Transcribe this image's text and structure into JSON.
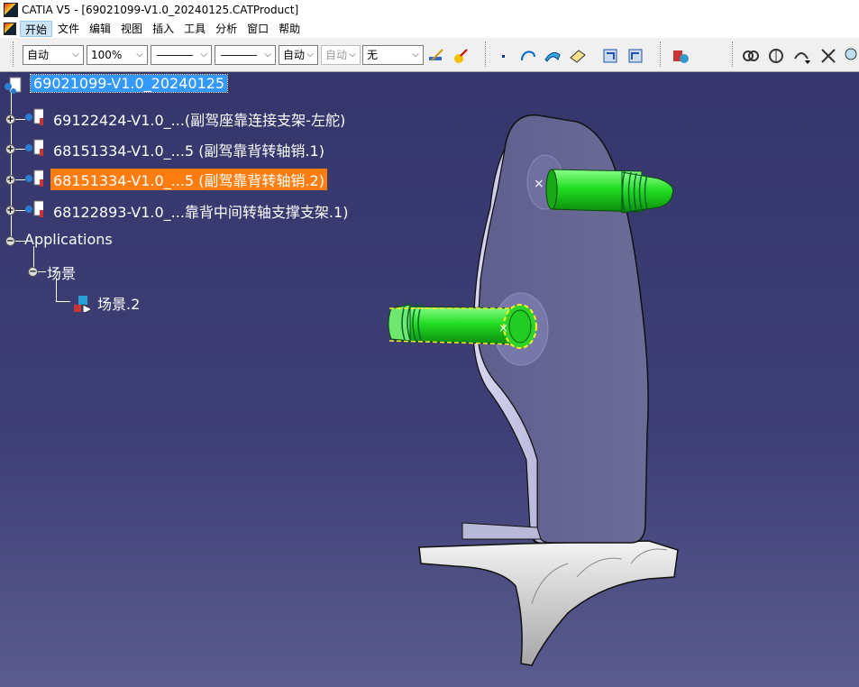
{
  "window": {
    "title": "CATIA V5 - [69021099-V1.0_20240125.CATProduct]"
  },
  "menu": {
    "items": [
      {
        "label": "开始",
        "active": true
      },
      {
        "label": "文件"
      },
      {
        "label": "编辑"
      },
      {
        "label": "视图"
      },
      {
        "label": "插入"
      },
      {
        "label": "工具"
      },
      {
        "label": "分析"
      },
      {
        "label": "窗口"
      },
      {
        "label": "帮助"
      }
    ]
  },
  "toolbar": {
    "color_combo": "自动",
    "transparency_combo": "100%",
    "linetype_combo": "",
    "lineweight_combo": "",
    "point_combo": "自动",
    "layer_combo_disabled": "自动",
    "layer_combo": "无",
    "icons": [
      "painter-icon",
      "format-painter-icon",
      "point-icon",
      "curve-icon",
      "surface-icon",
      "render-style-icon",
      "product-view-icon",
      "product-view2-icon",
      "catalog-icon",
      "constraint-icon",
      "compass-icon",
      "manipulate-icon",
      "fit-all-icon"
    ]
  },
  "tree": {
    "root": "69021099-V1.0_20240125",
    "children": [
      {
        "label": "69122424-V1.0_...(副驾座靠连接支架-左舵)"
      },
      {
        "label": "68151334-V1.0_...5 (副驾靠背转轴销.1)"
      },
      {
        "label": "68151334-V1.0_...5 (副驾靠背转轴销.2)",
        "selected": true
      },
      {
        "label": "68122893-V1.0_...靠背中间转轴支撑支架.1)"
      }
    ],
    "applications": "Applications",
    "scene_group": "场景",
    "scene_item": "场景.2"
  },
  "colors": {
    "viewport_top": "#35366b",
    "viewport_bottom": "#5a5b8e",
    "selection": "#ff7d10",
    "root_highlight": "#3399ff",
    "pin_green": "#22dd22"
  }
}
